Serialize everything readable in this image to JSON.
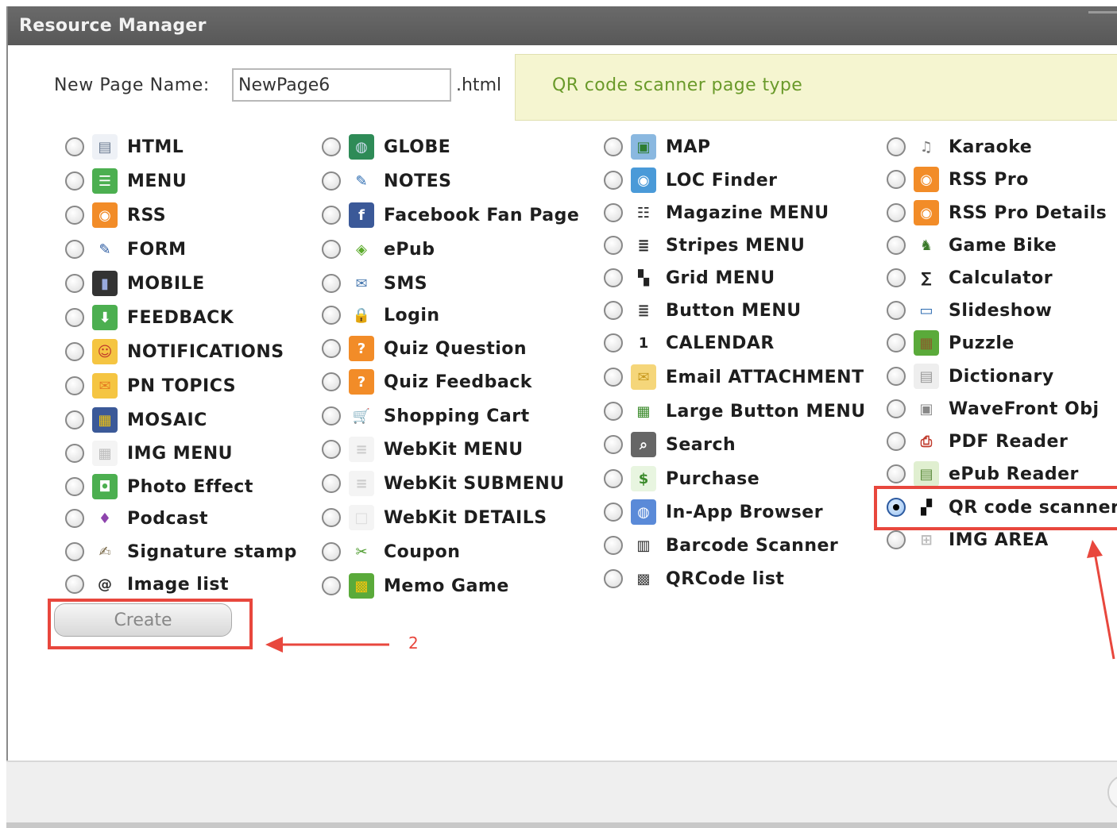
{
  "window": {
    "title": "Resource Manager"
  },
  "form": {
    "name_label": "New Page Name:",
    "name_value": "NewPage6",
    "extension": ".html"
  },
  "info": {
    "text": "QR code scanner page type"
  },
  "columns": [
    [
      {
        "label": "HTML",
        "icon": "html-page-icon"
      },
      {
        "label": "MENU",
        "icon": "menu-list-icon"
      },
      {
        "label": "RSS",
        "icon": "rss-feed-icon"
      },
      {
        "label": "FORM",
        "icon": "pencil-form-icon"
      },
      {
        "label": "MOBILE",
        "icon": "mobile-phone-icon"
      },
      {
        "label": "FEEDBACK",
        "icon": "feedback-download-icon"
      },
      {
        "label": "NOTIFICATIONS",
        "icon": "notification-smiley-icon"
      },
      {
        "label": "PN TOPICS",
        "icon": "pn-topics-icon"
      },
      {
        "label": "MOSAIC",
        "icon": "mosaic-tiles-icon"
      },
      {
        "label": "IMG MENU",
        "icon": "image-menu-grid-icon"
      },
      {
        "label": "Photo Effect",
        "icon": "camera-icon"
      },
      {
        "label": "Podcast",
        "icon": "microphone-icon"
      },
      {
        "label": "Signature stamp",
        "icon": "signature-stamp-icon"
      },
      {
        "label": "Image list",
        "icon": "at-sign-icon"
      }
    ],
    [
      {
        "label": "GLOBE",
        "icon": "globe-icon"
      },
      {
        "label": "NOTES",
        "icon": "notes-icon"
      },
      {
        "label": "Facebook Fan Page",
        "icon": "facebook-icon"
      },
      {
        "label": "ePub",
        "icon": "epub-icon"
      },
      {
        "label": "SMS",
        "icon": "envelope-icon"
      },
      {
        "label": "Login",
        "icon": "padlock-icon"
      },
      {
        "label": "Quiz Question",
        "icon": "quiz-question-icon"
      },
      {
        "label": "Quiz Feedback",
        "icon": "quiz-feedback-icon"
      },
      {
        "label": "Shopping Cart",
        "icon": "shopping-cart-icon"
      },
      {
        "label": "WebKit MENU",
        "icon": "webkit-menu-icon"
      },
      {
        "label": "WebKit SUBMENU",
        "icon": "webkit-submenu-icon"
      },
      {
        "label": "WebKit DETAILS",
        "icon": "webkit-details-icon"
      },
      {
        "label": "Coupon",
        "icon": "scissors-coupon-icon"
      },
      {
        "label": "Memo Game",
        "icon": "memo-game-icon"
      }
    ],
    [
      {
        "label": "MAP",
        "icon": "map-icon"
      },
      {
        "label": "LOC Finder",
        "icon": "location-finder-icon"
      },
      {
        "label": "Magazine MENU",
        "icon": "magazine-menu-icon"
      },
      {
        "label": "Stripes MENU",
        "icon": "stripes-menu-icon"
      },
      {
        "label": "Grid MENU",
        "icon": "grid-menu-icon"
      },
      {
        "label": "Button MENU",
        "icon": "button-menu-icon"
      },
      {
        "label": "CALENDAR",
        "icon": "calendar-icon"
      },
      {
        "label": "Email ATTACHMENT",
        "icon": "email-attachment-icon"
      },
      {
        "label": "Large Button MENU",
        "icon": "large-button-menu-icon"
      },
      {
        "label": "Search",
        "icon": "magnifier-icon"
      },
      {
        "label": "Purchase",
        "icon": "dollar-icon"
      },
      {
        "label": "In-App Browser",
        "icon": "browser-globe-icon"
      },
      {
        "label": "Barcode Scanner",
        "icon": "barcode-icon"
      },
      {
        "label": "QRCode list",
        "icon": "qrcode-list-icon"
      }
    ],
    [
      {
        "label": "Karaoke",
        "icon": "karaoke-microphone-icon"
      },
      {
        "label": "RSS Pro",
        "icon": "rss-pro-icon"
      },
      {
        "label": "RSS Pro Details",
        "icon": "rss-pro-details-icon"
      },
      {
        "label": "Game Bike",
        "icon": "game-bike-icon"
      },
      {
        "label": "Calculator",
        "icon": "sigma-calculator-icon"
      },
      {
        "label": "Slideshow",
        "icon": "slideshow-icon"
      },
      {
        "label": "Puzzle",
        "icon": "puzzle-icon"
      },
      {
        "label": "Dictionary",
        "icon": "dictionary-icon"
      },
      {
        "label": "WaveFront Obj",
        "icon": "wavefront-obj-icon"
      },
      {
        "label": "PDF Reader",
        "icon": "pdf-icon"
      },
      {
        "label": "ePub Reader",
        "icon": "epub-reader-icon"
      },
      {
        "label": "QR code scanner",
        "icon": "qr-code-icon",
        "selected": true
      },
      {
        "label": "IMG AREA",
        "icon": "image-area-icon"
      }
    ]
  ],
  "buttons": {
    "create": "Create"
  },
  "annotation": {
    "step_number": "2"
  },
  "colors": {
    "titlebar": "#5e5e5e",
    "annotation": "#e8473d",
    "info_text": "#6a9a2a",
    "info_bg": "#f5f5d0"
  }
}
